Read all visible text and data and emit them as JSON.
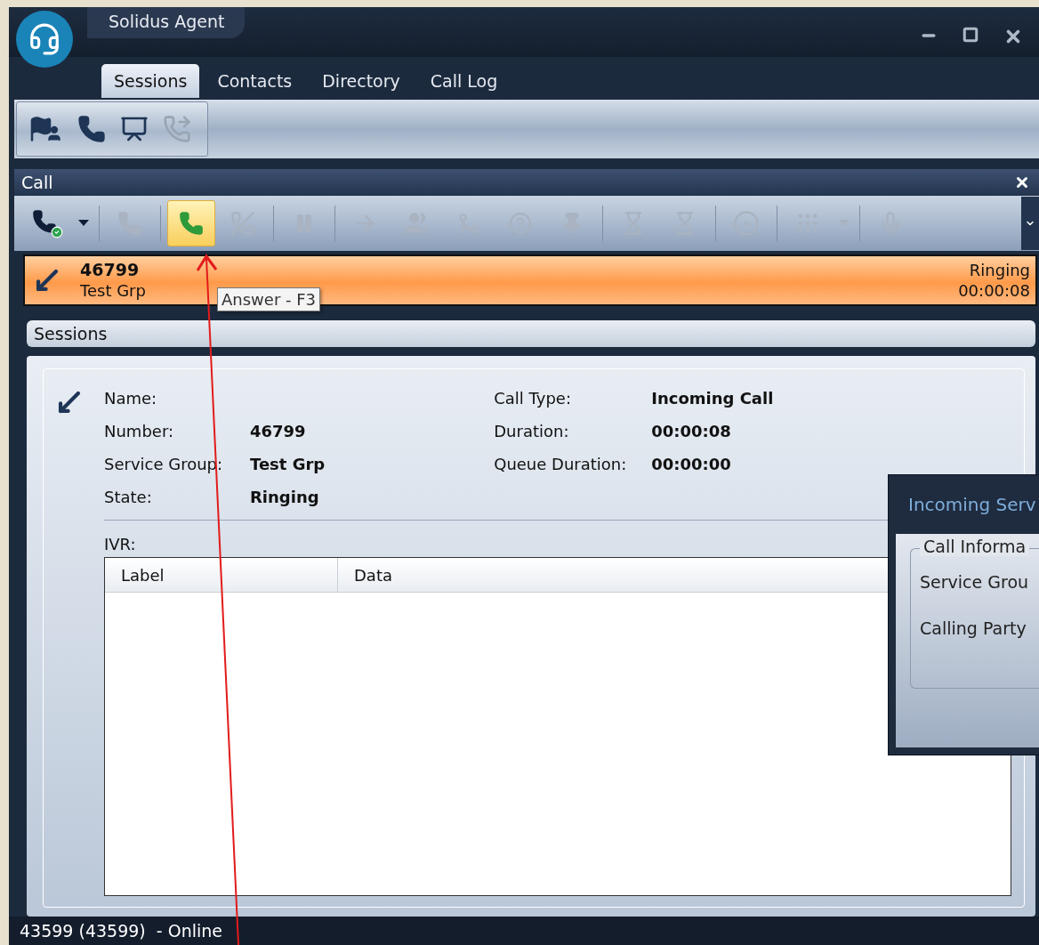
{
  "window": {
    "title": "Solidus Agent"
  },
  "tabs": [
    {
      "label": "Sessions",
      "selected": true
    },
    {
      "label": "Contacts",
      "selected": false
    },
    {
      "label": "Directory",
      "selected": false
    },
    {
      "label": "Call Log",
      "selected": false
    }
  ],
  "quick_toolbar": [
    {
      "kind": "agent",
      "disabled": false
    },
    {
      "kind": "phone",
      "disabled": false
    },
    {
      "kind": "report",
      "disabled": false
    },
    {
      "kind": "forward",
      "disabled": true
    }
  ],
  "call_panel": {
    "title": "Call",
    "toolbar": [
      {
        "kind": "status",
        "disabled": false,
        "highlighted": false
      },
      {
        "kind": "dropdown",
        "disabled": false,
        "highlighted": false
      },
      {
        "kind": "separator"
      },
      {
        "kind": "dial",
        "disabled": true,
        "highlighted": false
      },
      {
        "kind": "separator"
      },
      {
        "kind": "answer",
        "disabled": false,
        "highlighted": true
      },
      {
        "kind": "hangup",
        "disabled": true,
        "highlighted": false
      },
      {
        "kind": "separator"
      },
      {
        "kind": "hold",
        "disabled": true,
        "highlighted": false
      },
      {
        "kind": "separator"
      },
      {
        "kind": "transfer",
        "disabled": true,
        "highlighted": false
      },
      {
        "kind": "conference",
        "disabled": true,
        "highlighted": false
      },
      {
        "kind": "consult",
        "disabled": true,
        "highlighted": false
      },
      {
        "kind": "help",
        "disabled": true,
        "highlighted": false
      },
      {
        "kind": "pin",
        "disabled": true,
        "highlighted": false
      },
      {
        "kind": "separator"
      },
      {
        "kind": "wrapup",
        "disabled": true,
        "highlighted": false
      },
      {
        "kind": "wrapdown",
        "disabled": true,
        "highlighted": false
      },
      {
        "kind": "separator"
      },
      {
        "kind": "record",
        "disabled": true,
        "highlighted": false
      },
      {
        "kind": "separator"
      },
      {
        "kind": "keypad",
        "disabled": true,
        "highlighted": false
      },
      {
        "kind": "dropdown",
        "disabled": true,
        "highlighted": false
      },
      {
        "kind": "separator"
      },
      {
        "kind": "mic",
        "disabled": true,
        "highlighted": false
      }
    ],
    "tooltip": "Answer - F3",
    "active_call": {
      "number": "46799",
      "group": "Test Grp",
      "state": "Ringing",
      "duration": "00:00:08"
    }
  },
  "sessions": {
    "title": "Sessions",
    "left_details": [
      {
        "label": "Name:"
      },
      {
        "label": "Number:",
        "value": "46799"
      },
      {
        "label": "Service Group:",
        "value": "Test Grp"
      },
      {
        "label": "State:",
        "value": "Ringing"
      }
    ],
    "right_details": [
      {
        "label": "Call Type:",
        "value": "Incoming Call"
      },
      {
        "label": "Duration:",
        "value": "00:00:08"
      },
      {
        "label": "Queue Duration:",
        "value": "00:00:00"
      }
    ],
    "ivr_label": "IVR:",
    "table": {
      "columns": [
        "Label",
        "Data"
      ]
    }
  },
  "popup": {
    "title": "Incoming Serv",
    "group_title": "Call Informa",
    "labels": [
      "Service Grou",
      "Calling Party"
    ]
  },
  "status_bar": "43599 (43599)  - Online"
}
